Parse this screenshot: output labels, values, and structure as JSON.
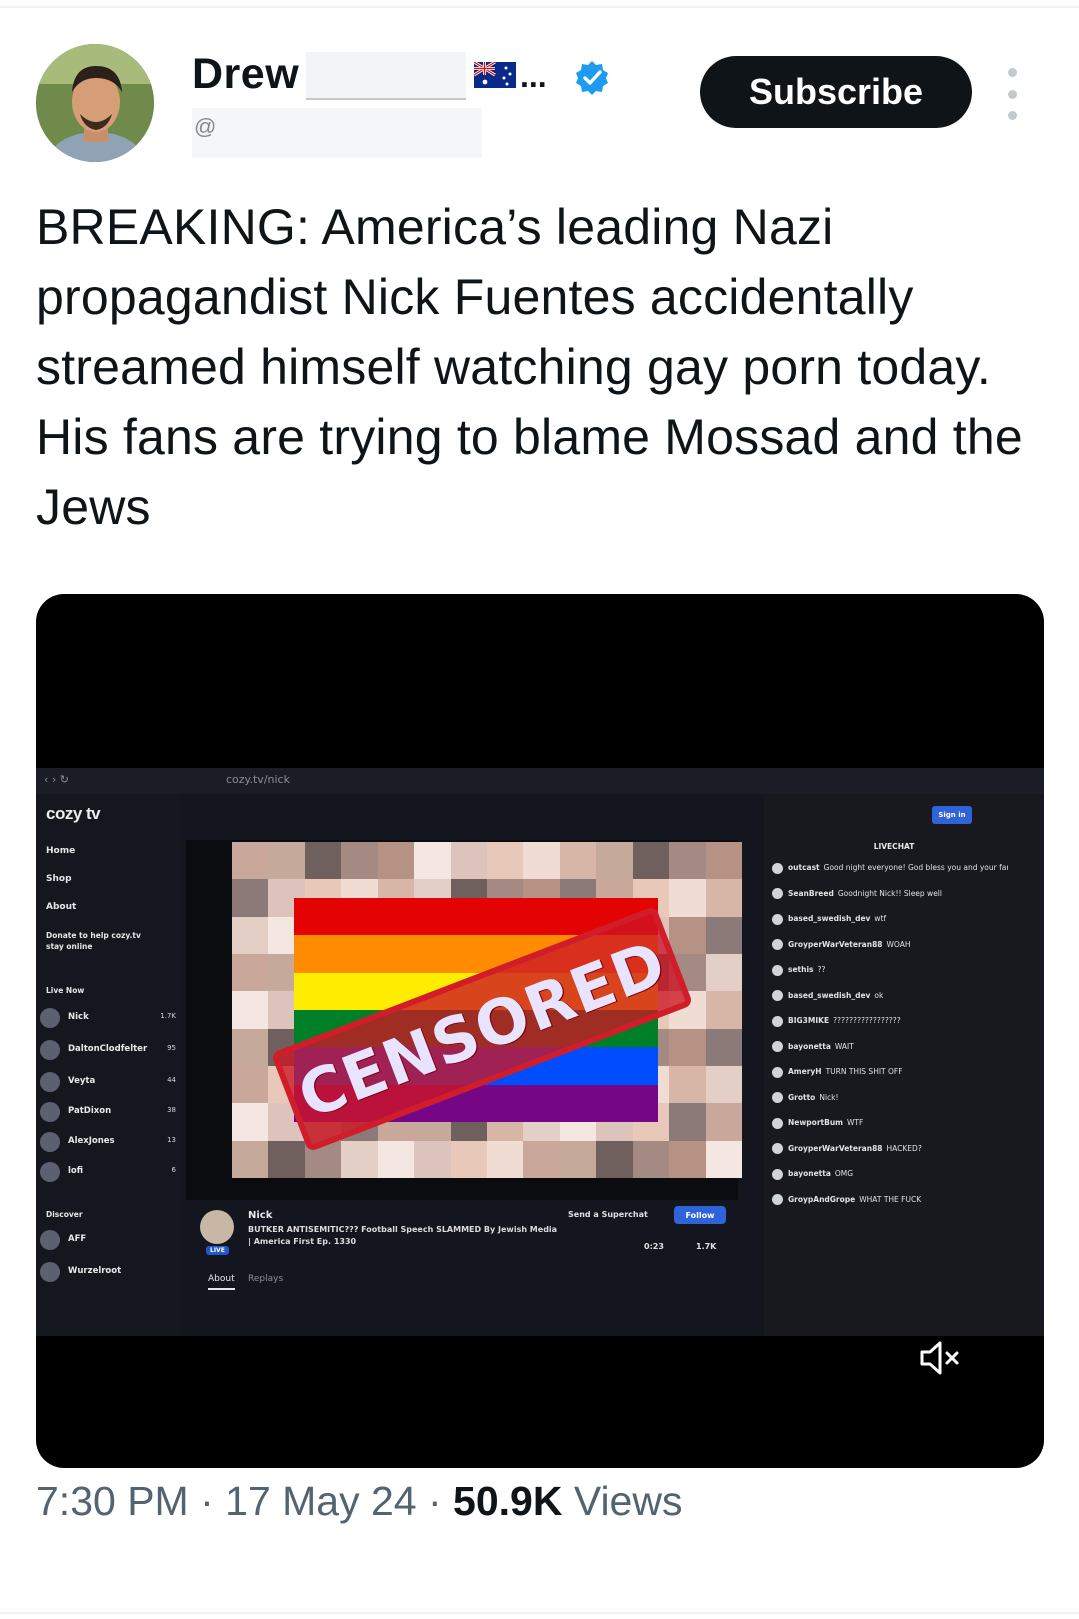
{
  "author": {
    "display_name": "Drew",
    "handle_visible": "@",
    "truncation": "..."
  },
  "subscribe_label": "Subscribe",
  "tweet_text": "BREAKING: America’s leading Nazi propagandist Nick Fuentes accidentally streamed himself watching gay porn today. His fans are trying to blame Mossad and the Jews",
  "media": {
    "browser_url": "cozy.tv/nick",
    "site": {
      "logo": "cozy tv",
      "nav": [
        "Home",
        "Shop",
        "About"
      ],
      "donate": "Donate to help cozy.tv stay online",
      "live_now_label": "Live Now",
      "channels": [
        {
          "name": "Nick",
          "viewers": "1.7K"
        },
        {
          "name": "DaltonClodfelter",
          "viewers": "95"
        },
        {
          "name": "Veyta",
          "viewers": "44"
        },
        {
          "name": "PatDixon",
          "viewers": "38"
        },
        {
          "name": "AlexJones",
          "viewers": "13"
        },
        {
          "name": "lofi",
          "viewers": "6"
        }
      ],
      "discover_label": "Discover",
      "discover_channels": [
        "AFF",
        "Wurzelroot"
      ],
      "sign_in": "Sign in",
      "censored_label": "CENSORED",
      "stream": {
        "streamer": "Nick",
        "live_badge": "LIVE",
        "title": "BUTKER ANTISEMITIC??? Football Speech SLAMMED By Jewish Media | America First Ep. 1330",
        "superchat": "Send a Superchat",
        "follow": "Follow",
        "uptime": "0:23",
        "viewers": "1.7K",
        "tabs": [
          "About",
          "Replays"
        ]
      },
      "chat_header": "LIVECHAT",
      "chat": [
        {
          "user": "outcast",
          "msg": "Good night everyone! God bless you and your families!"
        },
        {
          "user": "SeanBreed",
          "msg": "Goodnight Nick!! Sleep well"
        },
        {
          "user": "based_swedish_dev",
          "msg": "wtf"
        },
        {
          "user": "GroyperWarVeteran88",
          "msg": "WOAH"
        },
        {
          "user": "sethis",
          "msg": "??"
        },
        {
          "user": "based_swedish_dev",
          "msg": "ok"
        },
        {
          "user": "BIG3MIKE",
          "msg": "?????????????????"
        },
        {
          "user": "bayonetta",
          "msg": "WAIT"
        },
        {
          "user": "AmeryH",
          "msg": "TURN THIS SHIT OFF"
        },
        {
          "user": "Grotto",
          "msg": "Nick!"
        },
        {
          "user": "NewportBum",
          "msg": "WTF"
        },
        {
          "user": "GroyperWarVeteran88",
          "msg": "HACKED?"
        },
        {
          "user": "bayonetta",
          "msg": "OMG"
        },
        {
          "user": "GroypAndGrope",
          "msg": "WHAT THE FUCK"
        }
      ]
    }
  },
  "meta": {
    "time": "7:30 PM",
    "sep": " · ",
    "date": "17 May 24",
    "views_count": "50.9K",
    "views_label": " Views"
  },
  "colors": {
    "verified": "#1d9bf0",
    "text_primary": "#0f1419",
    "text_secondary": "#536471",
    "subscribe_bg": "#0f1419",
    "stamp_red": "#d11d2a",
    "pride_flag": [
      "#e40303",
      "#ff8c00",
      "#ffed00",
      "#008026",
      "#004dff",
      "#750787"
    ]
  },
  "icons": [
    "verified-icon",
    "australia-flag-icon",
    "more-options-icon",
    "mute-icon"
  ]
}
